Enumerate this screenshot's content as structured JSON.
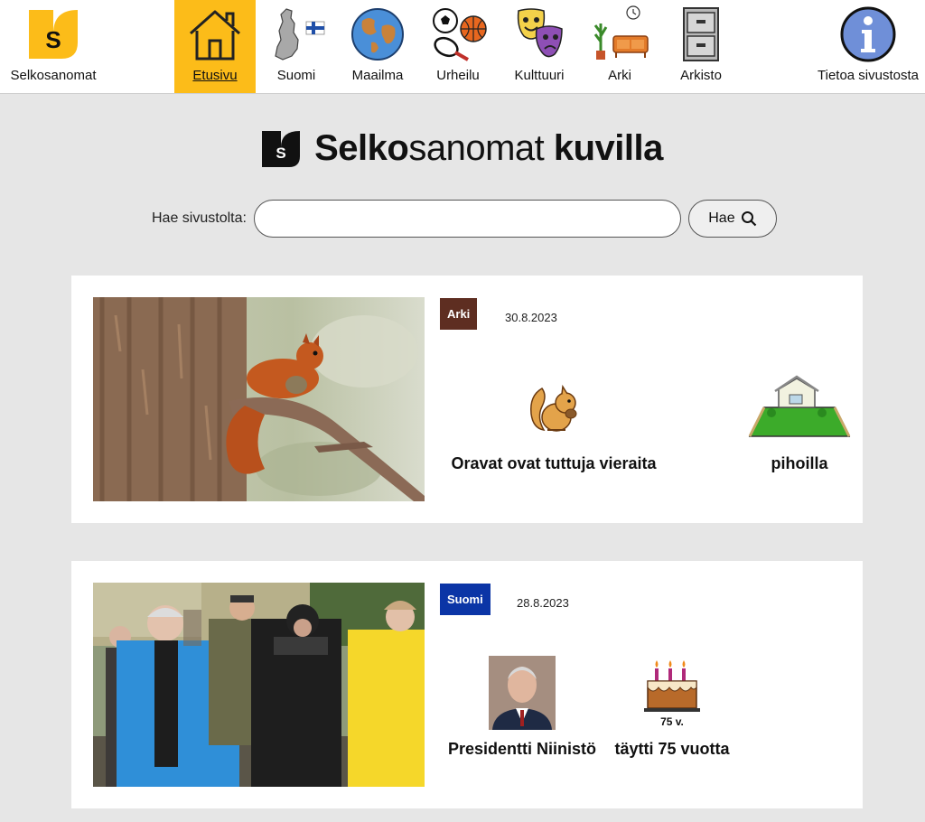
{
  "nav": {
    "brand": "Selkosanomat",
    "items": [
      {
        "label": "Etusivu",
        "icon": "house-icon",
        "active": true
      },
      {
        "label": "Suomi",
        "icon": "finland-map-icon"
      },
      {
        "label": "Maailma",
        "icon": "globe-icon"
      },
      {
        "label": "Urheilu",
        "icon": "sports-balls-icon"
      },
      {
        "label": "Kulttuuri",
        "icon": "theatre-masks-icon"
      },
      {
        "label": "Arki",
        "icon": "home-furniture-icon"
      },
      {
        "label": "Arkisto",
        "icon": "file-cabinet-icon"
      },
      {
        "label": "Tietoa sivustosta",
        "icon": "info-icon"
      }
    ]
  },
  "logo_letter": "S",
  "masthead": {
    "part1": "Selko",
    "part2": "sanomat",
    "part3": " kuvilla"
  },
  "search": {
    "label": "Hae sivustolta:",
    "value": "",
    "button": "Hae"
  },
  "articles": [
    {
      "category": "Arki",
      "category_color": "#5e2e21",
      "date": "30.8.2023",
      "photo": "squirrel-photo",
      "words": [
        {
          "text": "Oravat ovat tuttuja vieraita",
          "pic": "squirrel-symbol"
        },
        {
          "text": "pihoilla",
          "pic": "yard-symbol"
        }
      ]
    },
    {
      "category": "Suomi",
      "category_color": "#0b35a6",
      "date": "28.8.2023",
      "photo": "crowd-walk-photo",
      "words": [
        {
          "text": "Presidentti Niinistö",
          "pic": "president-portrait"
        },
        {
          "text": "täytti 75 vuotta",
          "pic": "birthday-cake-symbol"
        },
        {
          "text": "75 v.",
          "pic": "cake-label"
        }
      ]
    }
  ],
  "colors": {
    "accent": "#fcbc19",
    "arki": "#5e2e21",
    "suomi": "#0b35a6",
    "page_bg": "#e6e6e6"
  }
}
